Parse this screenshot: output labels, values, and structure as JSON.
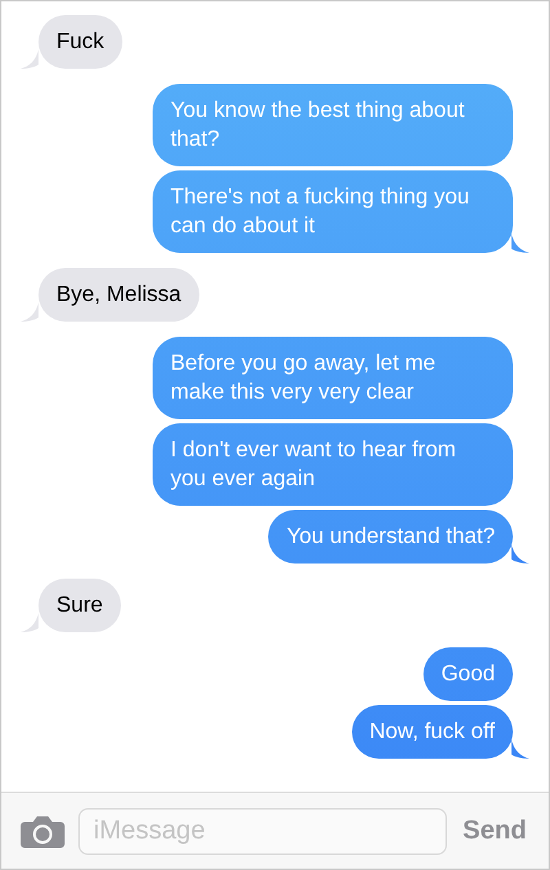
{
  "messages": [
    {
      "kind": "received",
      "text": "Fuck",
      "tail": true
    },
    {
      "kind": "sent",
      "text": "You know the best thing about that?",
      "tail": false
    },
    {
      "kind": "sent",
      "text": "There's not a fucking thing you can do about it",
      "tail": true
    },
    {
      "kind": "received",
      "text": "Bye, Melissa",
      "tail": true
    },
    {
      "kind": "sent",
      "text": "Before you go away, let me make this very very clear",
      "tail": false
    },
    {
      "kind": "sent",
      "text": "I don't ever want to hear from you ever again",
      "tail": false
    },
    {
      "kind": "sent",
      "text": "You understand that?",
      "tail": true
    },
    {
      "kind": "received",
      "text": "Sure",
      "tail": true
    },
    {
      "kind": "sent",
      "text": "Good",
      "tail": false
    },
    {
      "kind": "sent",
      "text": "Now, fuck off",
      "tail": true
    }
  ],
  "composer": {
    "placeholder": "iMessage",
    "send": "Send"
  }
}
